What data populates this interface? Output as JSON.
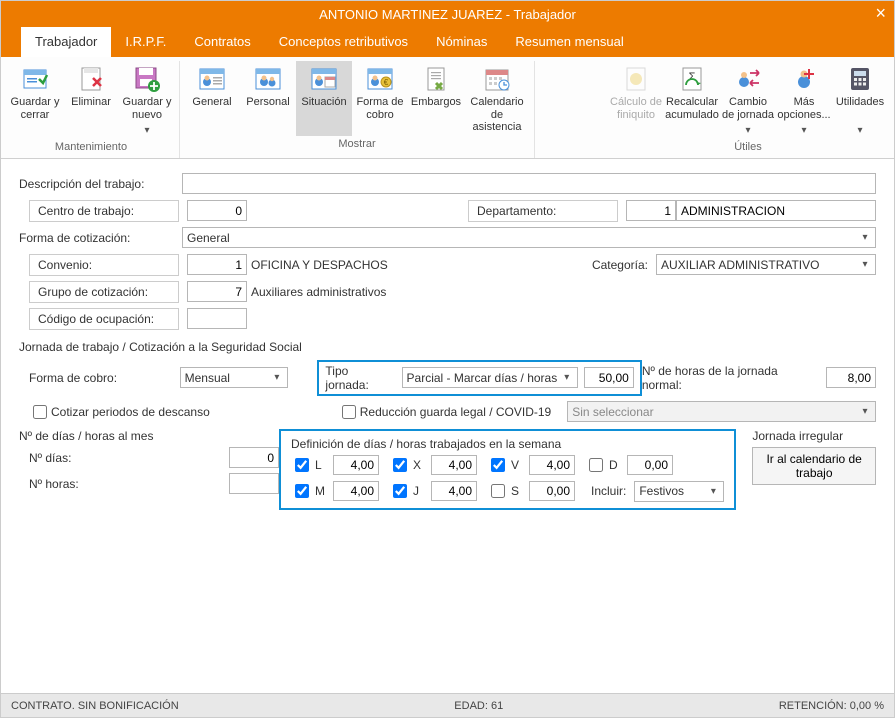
{
  "title": "ANTONIO MARTINEZ JUAREZ - Trabajador",
  "menu": {
    "tabs": [
      "Trabajador",
      "I.R.P.F.",
      "Contratos",
      "Conceptos retributivos",
      "Nóminas",
      "Resumen mensual"
    ],
    "active": 0
  },
  "ribbon": {
    "maint": {
      "label": "Mantenimiento",
      "save_close": "Guardar y cerrar",
      "delete": "Eliminar",
      "save_new": "Guardar y nuevo"
    },
    "show": {
      "label": "Mostrar",
      "general": "General",
      "personal": "Personal",
      "situacion": "Situación",
      "forma_cobro": "Forma de cobro",
      "embargos": "Embargos",
      "calendario": "Calendario de asistencia"
    },
    "utils": {
      "label": "Útiles",
      "finiquito": "Cálculo de finiquito",
      "recalcular": "Recalcular acumulado",
      "cambio": "Cambio de jornada",
      "mas": "Más opciones...",
      "utilidades": "Utilidades"
    }
  },
  "form": {
    "descripcion_label": "Descripción del trabajo:",
    "descripcion": "",
    "centro_label": "Centro de trabajo:",
    "centro_num": "0",
    "departamento_label": "Departamento:",
    "departamento_num": "1",
    "departamento_name": "ADMINISTRACION",
    "forma_cotizacion_label": "Forma de cotización:",
    "forma_cotizacion": "General",
    "convenio_label": "Convenio:",
    "convenio_num": "1",
    "convenio_name": "OFICINA Y DESPACHOS",
    "categoria_label": "Categoría:",
    "categoria": "AUXILIAR ADMINISTRATIVO",
    "grupo_cot_label": "Grupo de cotización:",
    "grupo_cot_num": "7",
    "grupo_cot_name": "Auxiliares administrativos",
    "codigo_ocup_label": "Código de ocupación:",
    "codigo_ocup": "",
    "section_jornada": "Jornada de trabajo / Cotización a la Seguridad Social",
    "forma_cobro_label": "Forma de cobro:",
    "forma_cobro": "Mensual",
    "tipo_jornada_label": "Tipo jornada:",
    "tipo_jornada": "Parcial - Marcar días / horas",
    "tipo_jornada_pct": "50,00",
    "horas_normal_label": "Nº de horas de la jornada normal:",
    "horas_normal": "8,00",
    "cotizar_descanso": "Cotizar periodos de descanso",
    "reduccion": "Reducción guarda legal / COVID-19",
    "reduccion_sel": "Sin seleccionar",
    "dias_mes_label": "Nº de días / horas al mes",
    "n_dias_label": "Nº días:",
    "n_dias": "0",
    "n_horas_label": "Nº horas:",
    "n_horas": "",
    "def_dias_label": "Definición de días / horas trabajados en la semana",
    "days": {
      "L": {
        "label": "L",
        "checked": true,
        "value": "4,00"
      },
      "M": {
        "label": "M",
        "checked": true,
        "value": "4,00"
      },
      "X": {
        "label": "X",
        "checked": true,
        "value": "4,00"
      },
      "J": {
        "label": "J",
        "checked": true,
        "value": "4,00"
      },
      "V": {
        "label": "V",
        "checked": true,
        "value": "4,00"
      },
      "S": {
        "label": "S",
        "checked": false,
        "value": "0,00"
      },
      "D": {
        "label": "D",
        "checked": false,
        "value": "0,00"
      }
    },
    "incluir_label": "Incluir:",
    "incluir": "Festivos",
    "jornada_irregular_label": "Jornada irregular",
    "ir_calendario": "Ir al calendario de trabajo"
  },
  "status": {
    "contrato": "CONTRATO.  SIN BONIFICACIÓN",
    "edad": "EDAD: 61",
    "retencion": "RETENCIÓN: 0,00 %"
  }
}
